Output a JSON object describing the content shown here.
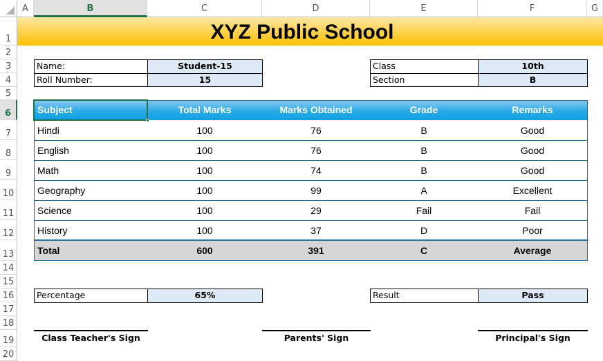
{
  "spreadsheet": {
    "columns": [
      "A",
      "B",
      "C",
      "D",
      "E",
      "F",
      "G"
    ],
    "selected_column": "B",
    "rows": [
      "1",
      "2",
      "3",
      "4",
      "5",
      "6",
      "7",
      "8",
      "9",
      "10",
      "11",
      "12",
      "13",
      "14",
      "15",
      "16",
      "17",
      "18",
      "19",
      "20"
    ],
    "selected_row": "6",
    "selected_cell": "B6"
  },
  "title": "XYZ Public School",
  "student_info": {
    "name_label": "Name:",
    "name_value": "Student-15",
    "roll_label": "Roll Number:",
    "roll_value": "15",
    "class_label": "Class",
    "class_value": "10th",
    "section_label": "Section",
    "section_value": "B"
  },
  "marks_table": {
    "headers": [
      "Subject",
      "Total Marks",
      "Marks Obtained",
      "Grade",
      "Remarks"
    ],
    "rows": [
      {
        "subject": "Hindi",
        "total": "100",
        "obtained": "76",
        "grade": "B",
        "remarks": "Good"
      },
      {
        "subject": "English",
        "total": "100",
        "obtained": "76",
        "grade": "B",
        "remarks": "Good"
      },
      {
        "subject": "Math",
        "total": "100",
        "obtained": "74",
        "grade": "B",
        "remarks": "Good"
      },
      {
        "subject": "Geography",
        "total": "100",
        "obtained": "99",
        "grade": "A",
        "remarks": "Excellent"
      },
      {
        "subject": "Science",
        "total": "100",
        "obtained": "29",
        "grade": "Fail",
        "remarks": "Fail"
      },
      {
        "subject": "History",
        "total": "100",
        "obtained": "37",
        "grade": "D",
        "remarks": "Poor"
      }
    ],
    "total": {
      "subject": "Total",
      "total": "600",
      "obtained": "391",
      "grade": "C",
      "remarks": "Average"
    }
  },
  "summary": {
    "percentage_label": "Percentage",
    "percentage_value": "65%",
    "result_label": "Result",
    "result_value": "Pass"
  },
  "signatures": {
    "teacher": "Class Teacher's Sign",
    "parents": "Parents' Sign",
    "principal": "Principal's Sign"
  },
  "colors": {
    "title_band": "#fcc200",
    "table_header": "#29aae6",
    "value_cell": "#dde9f5",
    "total_row": "#d6d6d6",
    "selection": "#217346"
  }
}
